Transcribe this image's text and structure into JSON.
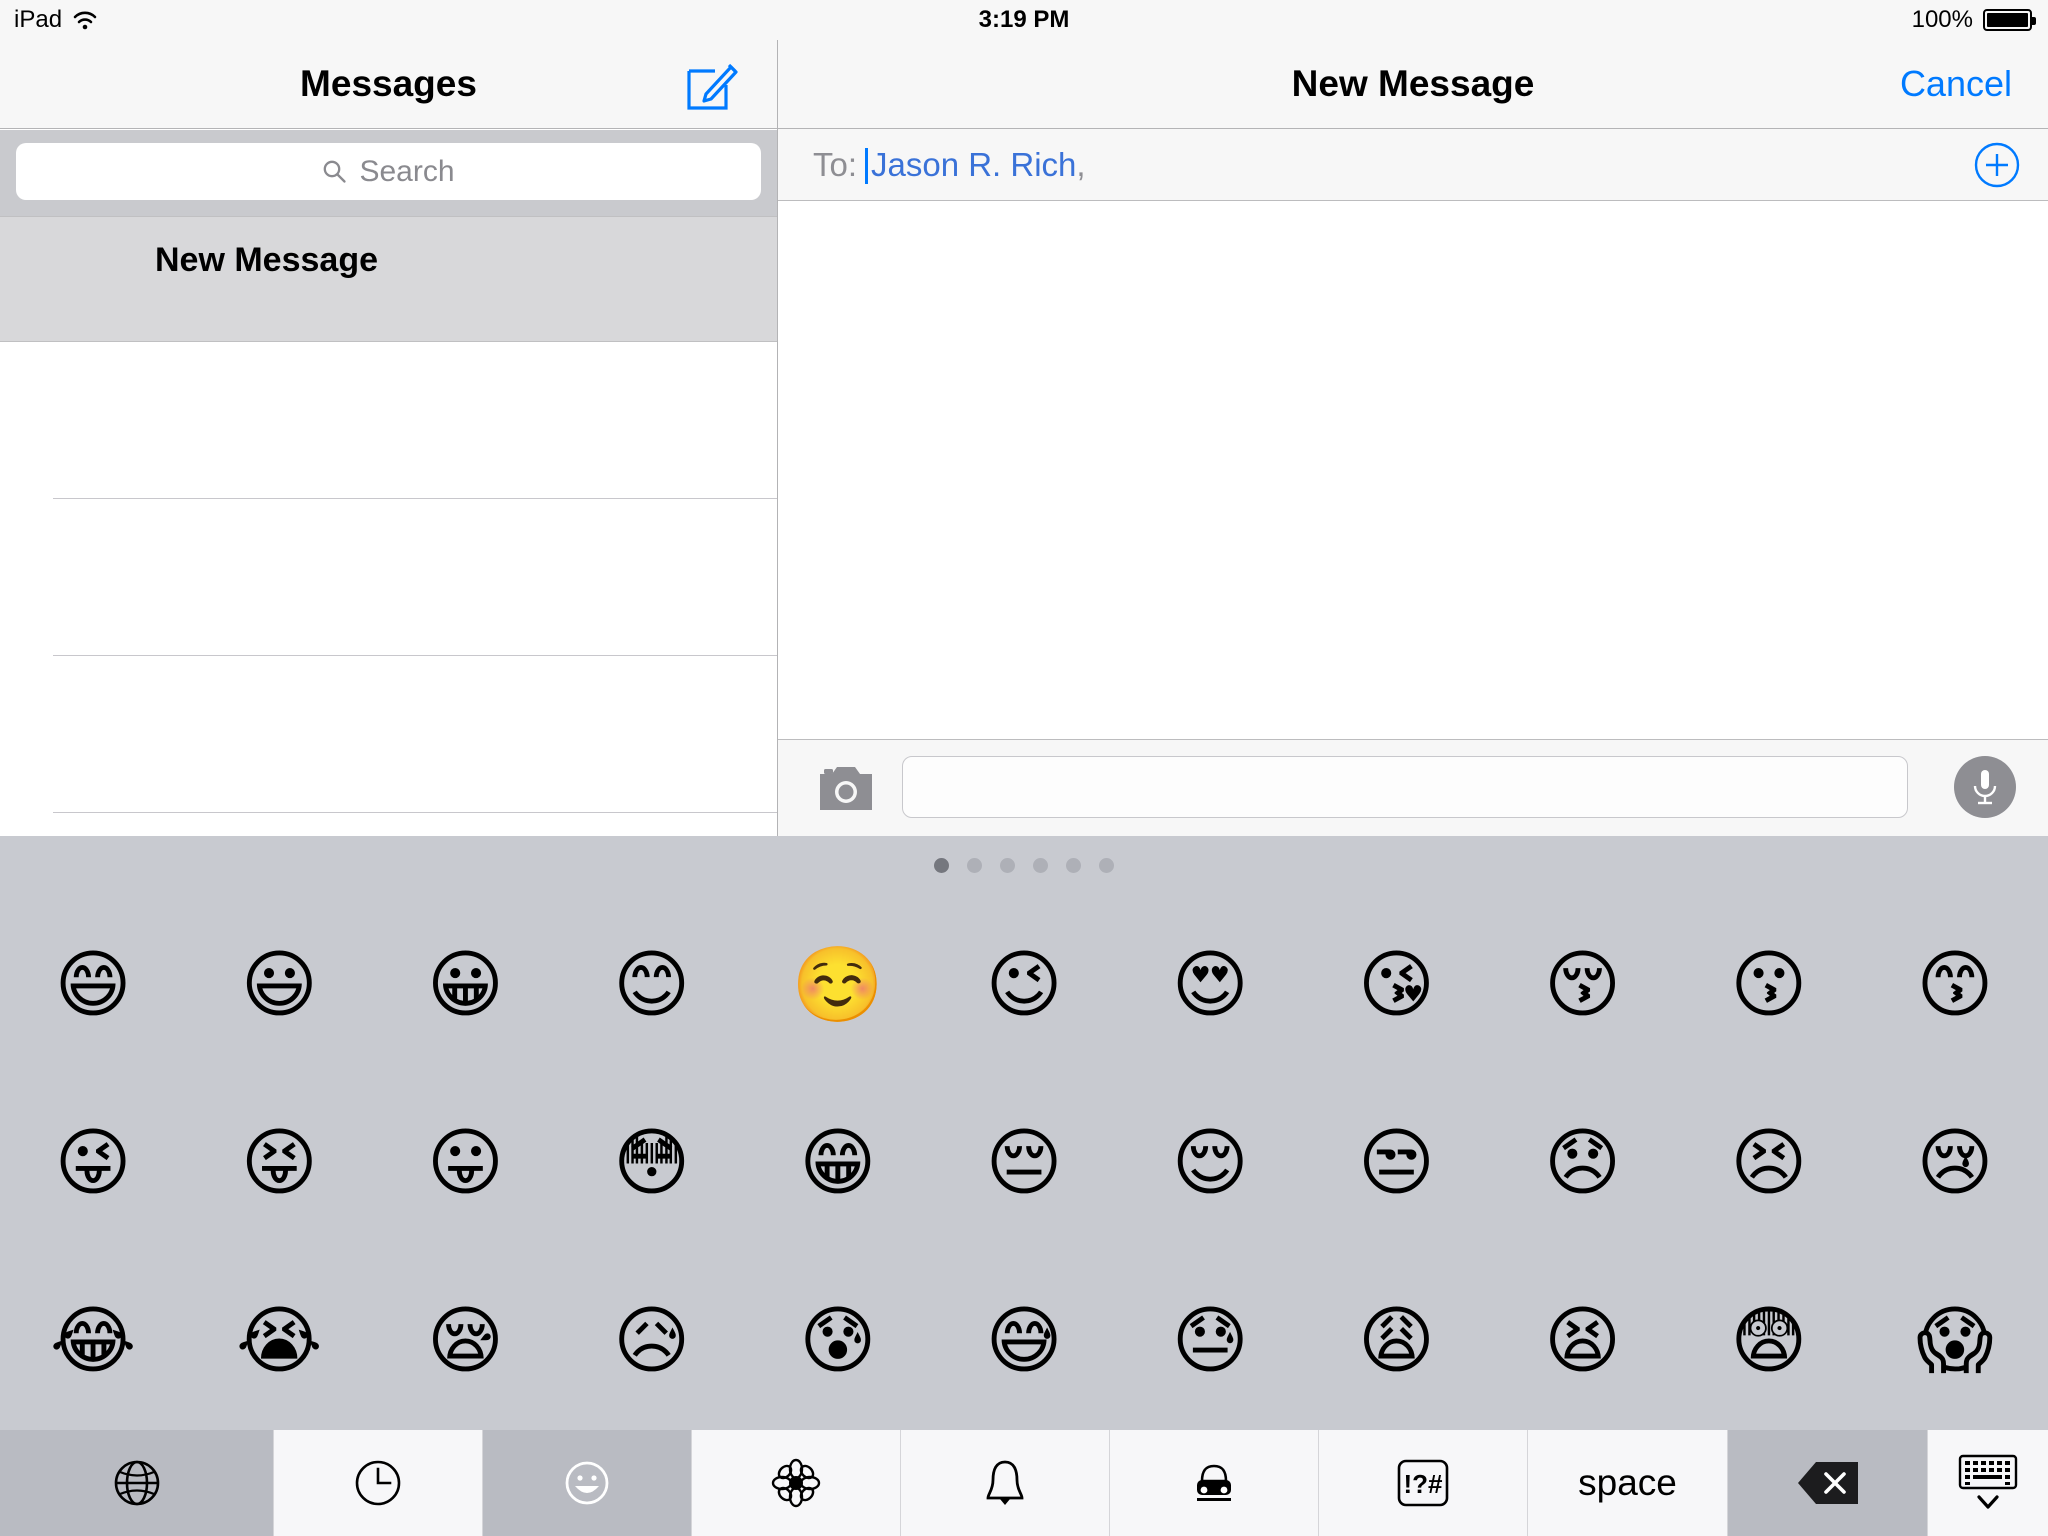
{
  "status_bar": {
    "carrier": "iPad",
    "wifi_icon": "wifi-icon",
    "time": "3:19 PM",
    "battery_percent": "100%",
    "battery_level": 100
  },
  "left_pane": {
    "title": "Messages",
    "compose_icon": "compose-pencil-icon",
    "search": {
      "icon": "search-icon",
      "placeholder": "Search",
      "value": ""
    },
    "conversations": [
      {
        "title": "New Message",
        "selected": true
      },
      {
        "title": "",
        "selected": false
      },
      {
        "title": "",
        "selected": false
      },
      {
        "title": "",
        "selected": false
      }
    ]
  },
  "right_pane": {
    "title": "New Message",
    "cancel_label": "Cancel",
    "to_field": {
      "label": "To:",
      "recipient": "Jason R. Rich",
      "separator": ",",
      "add_contact_icon": "add-contact-plus-icon"
    },
    "compose_bar": {
      "camera_icon": "camera-icon",
      "message_placeholder": "",
      "message_value": "",
      "mic_icon": "microphone-icon"
    }
  },
  "keyboard": {
    "pages": {
      "total": 6,
      "active_index": 0
    },
    "emoji_rows": [
      [
        "😄",
        "😃",
        "😀",
        "😊",
        "☺️",
        "😉",
        "😍",
        "😘",
        "😚",
        "😗",
        "😙"
      ],
      [
        "😜",
        "😝",
        "😛",
        "😳",
        "😁",
        "😔",
        "😌",
        "😒",
        "😞",
        "😣",
        "😢"
      ],
      [
        "😂",
        "😭",
        "😪",
        "😥",
        "😰",
        "😅",
        "😓",
        "😩",
        "😫",
        "😨",
        "😱"
      ]
    ],
    "toolbar": [
      {
        "name": "globe-icon",
        "label": "",
        "icon": "globe",
        "selected": true
      },
      {
        "name": "recent-clock-icon",
        "label": "",
        "icon": "clock",
        "selected": false
      },
      {
        "name": "people-smiley-icon",
        "label": "",
        "icon": "smiley",
        "selected": true
      },
      {
        "name": "nature-flower-icon",
        "label": "",
        "icon": "flower",
        "selected": false
      },
      {
        "name": "objects-bell-icon",
        "label": "",
        "icon": "bell",
        "selected": false
      },
      {
        "name": "travel-car-icon",
        "label": "",
        "icon": "car",
        "selected": false
      },
      {
        "name": "symbols-icon",
        "label": "!?#",
        "icon": "symbols",
        "selected": false
      },
      {
        "name": "space-key",
        "label": "space",
        "icon": "",
        "selected": false
      },
      {
        "name": "delete-backspace-icon",
        "label": "",
        "icon": "delete",
        "selected": true
      },
      {
        "name": "hide-keyboard-icon",
        "label": "",
        "icon": "hidekb",
        "selected": false
      }
    ]
  },
  "colors": {
    "accent_blue": "#007aff",
    "recipient_blue": "#3a72d8",
    "keyboard_bg": "#c8cad0",
    "navbar_bg": "#f7f7f7",
    "selected_row": "#d8d8da"
  }
}
